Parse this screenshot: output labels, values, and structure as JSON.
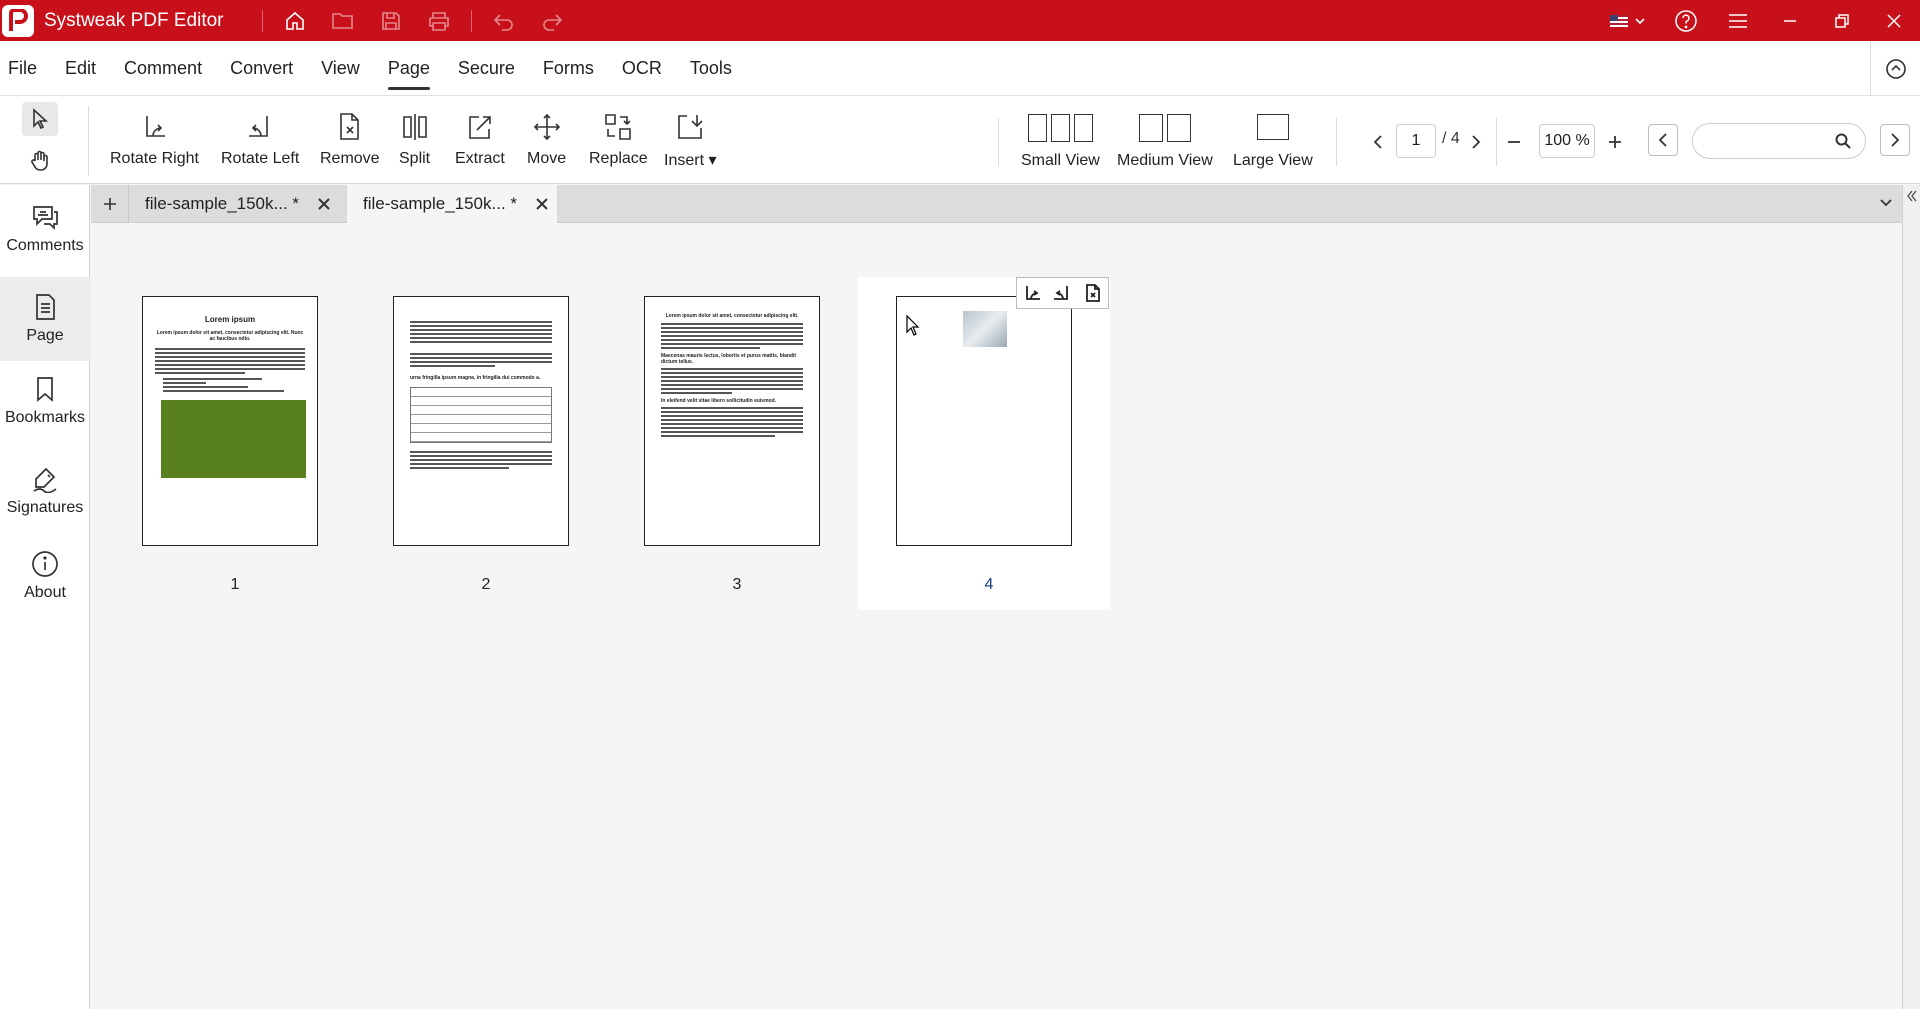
{
  "app": {
    "title": "Systweak PDF Editor"
  },
  "menu": {
    "items": [
      "File",
      "Edit",
      "Comment",
      "Convert",
      "View",
      "Page",
      "Secure",
      "Forms",
      "OCR",
      "Tools"
    ],
    "active": "Page"
  },
  "ribbon": {
    "rotate_right": "Rotate Right",
    "rotate_left": "Rotate Left",
    "remove": "Remove",
    "split": "Split",
    "extract": "Extract",
    "move": "Move",
    "replace": "Replace",
    "insert": "Insert",
    "small_view": "Small View",
    "medium_view": "Medium View",
    "large_view": "Large View"
  },
  "navigation": {
    "current_page": "1",
    "total_pages": "/ 4",
    "zoom": "100 %",
    "search_placeholder": ""
  },
  "sidebar": {
    "items": [
      "Comments",
      "Page",
      "Bookmarks",
      "Signatures",
      "About"
    ],
    "active": "Page"
  },
  "tabs": [
    {
      "label": "file-sample_150k... *",
      "active": false
    },
    {
      "label": "file-sample_150k... *",
      "active": true
    }
  ],
  "pages": [
    {
      "number": "1",
      "heading": "Lorem ipsum",
      "subheading": "Lorem ipsum dolor sit amet, consectetur adipiscing elit. Nunc ac faucibus odio."
    },
    {
      "number": "2",
      "heading": "urna fringilla ipsum magna, in fringilla dui commodo a."
    },
    {
      "number": "3",
      "heading": "Lorem ipsum dolor sit amet, consectetur adipiscing elit.",
      "sub1": "Maecenas mauris lectus, lobortis et purus mattis, blandit dictum tellus.",
      "sub2": "In eleifend velit vitae libero sollicitudin euismod."
    },
    {
      "number": "4",
      "selected": true
    }
  ],
  "colors": {
    "titlebar": "#c8101b",
    "page_image_green": "#58801f",
    "selected_page_number": "#1d3f8f"
  }
}
